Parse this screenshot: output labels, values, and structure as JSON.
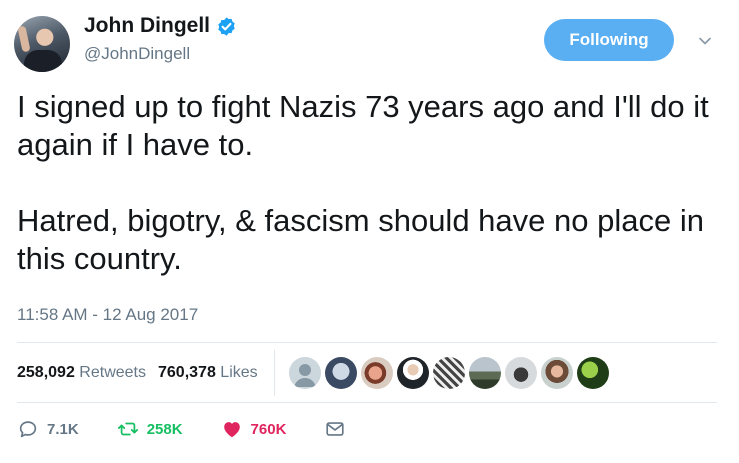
{
  "user": {
    "display_name": "John Dingell",
    "handle": "@JohnDingell",
    "follow_label": "Following"
  },
  "tweet": {
    "paragraph_1": "I signed up to fight Nazis 73 years ago and I'll do it again if I have to.",
    "paragraph_2": "Hatred, bigotry, & fascism should have no place in this country.",
    "timestamp": "11:58 AM - 12 Aug 2017"
  },
  "stats": {
    "retweets_count": "258,092",
    "retweets_label": "Retweets",
    "likes_count": "760,378",
    "likes_label": "Likes"
  },
  "actions": {
    "reply_count": "7.1K",
    "retweet_count": "258K",
    "like_count": "760K"
  },
  "colors": {
    "follow_button": "#5aaef2",
    "verified": "#1da1f2",
    "retweet": "#17bf63",
    "like": "#e0245e",
    "muted": "#657786"
  },
  "icons": [
    "verified-badge-icon",
    "chevron-down-icon",
    "reply-icon",
    "retweet-icon",
    "heart-icon",
    "direct-message-icon"
  ]
}
